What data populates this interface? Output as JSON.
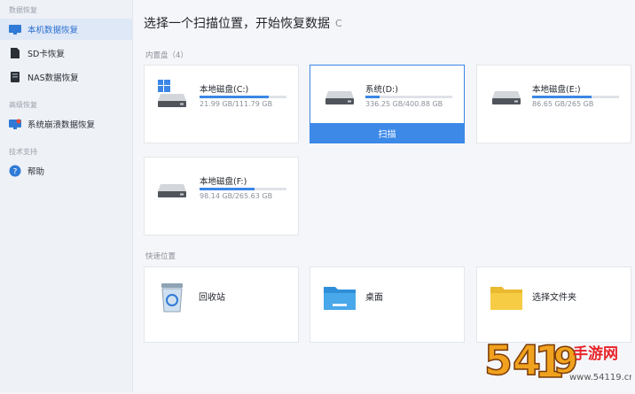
{
  "sidebar": {
    "section1": "数据恢复",
    "item_local": "本机数据恢复",
    "item_sd": "SD卡恢复",
    "item_nas": "NAS数据恢复",
    "section2": "高级恢复",
    "item_crash": "系统崩溃数据恢复",
    "section3": "技术支持",
    "item_help": "帮助"
  },
  "main": {
    "title": "选择一个扫描位置，开始恢复数据",
    "refresh_icon": "C",
    "internal_label": "内置盘（4）",
    "quick_label": "快速位置",
    "scan_label": "扫描"
  },
  "drives": [
    {
      "name": "本地磁盘(C:)",
      "size": "21.99 GB/111.79 GB",
      "used_fraction": 0.8
    },
    {
      "name": "系统(D:)",
      "size": "336.25 GB/400.88 GB",
      "used_fraction": 0.16
    },
    {
      "name": "本地磁盘(E:)",
      "size": "86.65 GB/265 GB",
      "used_fraction": 0.68
    },
    {
      "name": "本地磁盘(F:)",
      "size": "98.14 GB/265.63 GB",
      "used_fraction": 0.63
    }
  ],
  "locations": [
    {
      "name": "回收站",
      "icon": "recycle-bin-icon"
    },
    {
      "name": "桌面",
      "icon": "desktop-folder-icon"
    },
    {
      "name": "选择文件夹",
      "icon": "folder-icon"
    }
  ],
  "watermark": {
    "text": "54119手游网",
    "url": "www.54119.cn"
  },
  "colors": {
    "accent": "#3d89e8",
    "sidebar_active_bg": "#dfe8f7"
  }
}
